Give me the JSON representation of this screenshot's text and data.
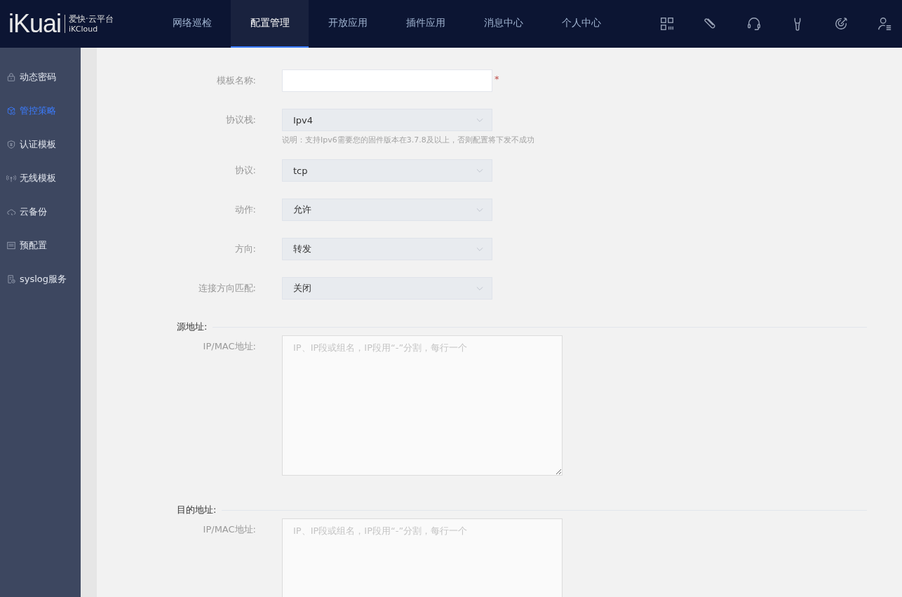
{
  "header": {
    "logo": "iKuai",
    "logo_title": "爱快·云平台",
    "logo_subtitle": "iKCloud",
    "nav": [
      {
        "label": "网络巡检",
        "selected": false
      },
      {
        "label": "配置管理",
        "selected": true
      },
      {
        "label": "开放应用",
        "selected": false
      },
      {
        "label": "插件应用",
        "selected": false
      },
      {
        "label": "消息中心",
        "selected": false
      },
      {
        "label": "个人中心",
        "selected": false
      }
    ],
    "tools": [
      {
        "kind": "grid"
      },
      {
        "kind": "clip"
      },
      {
        "kind": "headset"
      },
      {
        "kind": "wrench"
      },
      {
        "kind": "target"
      },
      {
        "kind": "user"
      }
    ]
  },
  "sidebar": {
    "items": [
      {
        "label": "动态密码",
        "kind": "lock",
        "selected": false
      },
      {
        "label": "管控策略",
        "kind": "cube",
        "selected": true
      },
      {
        "label": "认证模板",
        "kind": "shield",
        "selected": false
      },
      {
        "label": "无线模板",
        "kind": "antenna",
        "selected": false
      },
      {
        "label": "云备份",
        "kind": "cloud",
        "selected": false
      },
      {
        "label": "预配置",
        "kind": "panel",
        "selected": false
      },
      {
        "label": "syslog服务",
        "kind": "doc",
        "selected": false
      }
    ]
  },
  "form": [
    {
      "kind": "text",
      "label": "模板名称:",
      "required_mark": "*"
    },
    {
      "kind": "select",
      "label": "协议栈:",
      "value": "Ipv4",
      "note": "说明：支持Ipv6需要您的固件版本在3.7.8及以上，否则配置将下发不成功"
    },
    {
      "kind": "select",
      "label": "协议:",
      "value": "tcp"
    },
    {
      "kind": "select",
      "label": "动作:",
      "value": "允许"
    },
    {
      "kind": "select",
      "label": "方向:",
      "value": "转发"
    },
    {
      "kind": "select",
      "label": "连接方向匹配:",
      "value": "关闭"
    },
    {
      "kind": "section",
      "label": "源地址:"
    },
    {
      "kind": "textarea",
      "label": "IP/MAC地址:",
      "placeholder": "IP、IP段或组名，IP段用“-”分割，每行一个"
    },
    {
      "kind": "section",
      "label": "目的地址:"
    },
    {
      "kind": "textarea",
      "label": "IP/MAC地址:",
      "placeholder": "IP、IP段或组名，IP段用“-”分割，每行一个"
    }
  ]
}
